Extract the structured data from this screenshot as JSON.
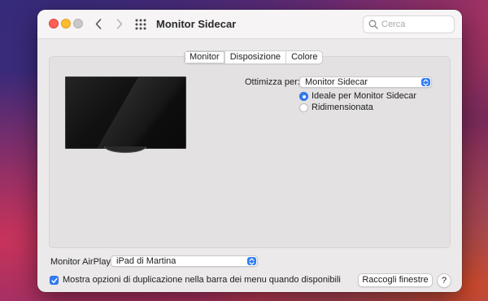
{
  "window": {
    "title": "Monitor Sidecar",
    "search_placeholder": "Cerca"
  },
  "tabs": [
    {
      "label": "Monitor",
      "active": true
    },
    {
      "label": "Disposizione",
      "active": false
    },
    {
      "label": "Colore",
      "active": false
    }
  ],
  "optimize": {
    "label": "Ottimizza per:",
    "selected": "Monitor Sidecar",
    "options": [
      {
        "label": "Ideale per Monitor Sidecar",
        "selected": true
      },
      {
        "label": "Ridimensionata",
        "selected": false
      }
    ]
  },
  "airplay": {
    "label": "Monitor AirPlay:",
    "selected": "iPad di Martina"
  },
  "mirror_option": {
    "label": "Mostra opzioni di duplicazione nella barra dei menu quando disponibili",
    "checked": true
  },
  "buttons": {
    "gather": "Raccogli finestre",
    "help": "?"
  },
  "icons": {
    "back": "chevron-left-icon",
    "forward": "chevron-right-icon",
    "grid": "grid-icon",
    "search": "search-icon",
    "popup": "chevron-updown-icon",
    "checkmark": "checkmark-icon"
  },
  "colors": {
    "accent": "#2f7cf6",
    "close": "#ff5f57",
    "minimize": "#febc2e"
  }
}
